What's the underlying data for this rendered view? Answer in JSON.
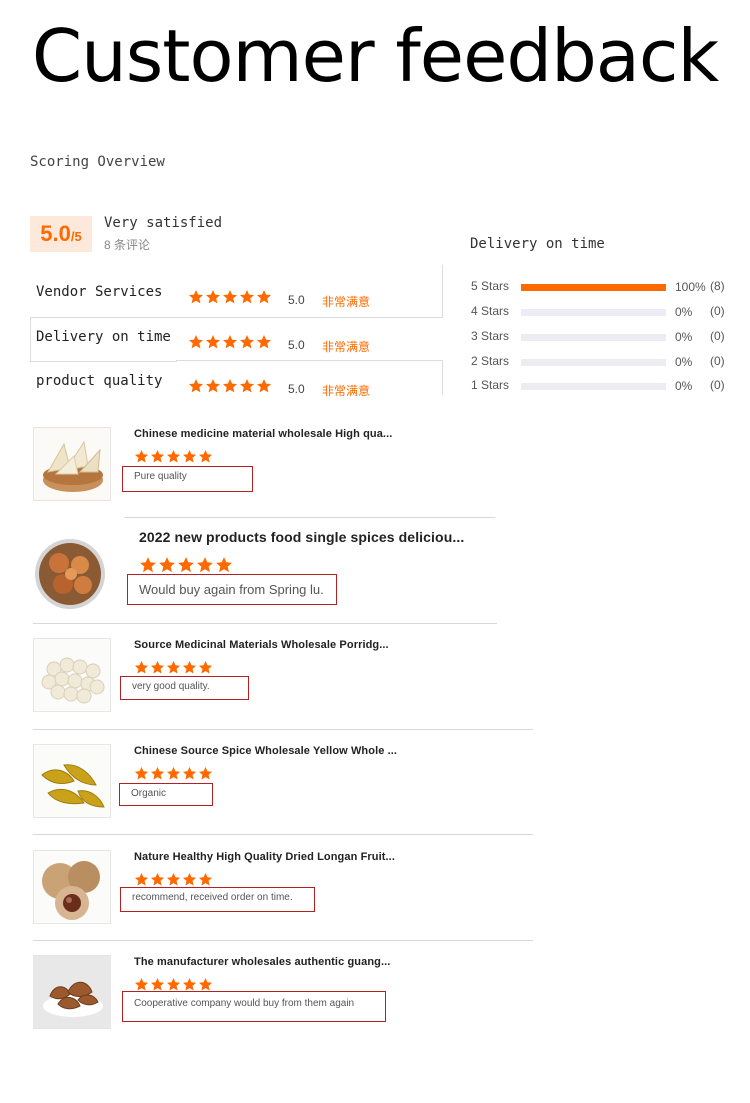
{
  "header": {
    "title": "Customer feedback"
  },
  "overview": {
    "section_title": "Scoring Overview",
    "score": "5.0",
    "score_total": "/5",
    "overall_label": "Very satisfied",
    "review_count": "8 条评论"
  },
  "criteria": [
    {
      "label": "Vendor Services",
      "score": "5.0",
      "text": "非常满意",
      "stars": 5
    },
    {
      "label": "Delivery on time",
      "score": "5.0",
      "text": "非常满意",
      "stars": 5
    },
    {
      "label": "product quality",
      "score": "5.0",
      "text": "非常满意",
      "stars": 5
    }
  ],
  "distribution": {
    "title": "Delivery on time",
    "rows": [
      {
        "label": "5 Stars",
        "percent": "100%",
        "count": "(8)",
        "fraction": 1.0
      },
      {
        "label": "4 Stars",
        "percent": "0%",
        "count": "(0)",
        "fraction": 0
      },
      {
        "label": "3 Stars",
        "percent": "0%",
        "count": "(0)",
        "fraction": 0
      },
      {
        "label": "2 Stars",
        "percent": "0%",
        "count": "(0)",
        "fraction": 0
      },
      {
        "label": "1 Stars",
        "percent": "0%",
        "count": "(0)",
        "fraction": 0
      }
    ]
  },
  "reviews": [
    {
      "title": "Chinese medicine material wholesale High qua...",
      "comment": "Pure quality",
      "stars": 5,
      "image": "sliced-herb-bowl-image"
    },
    {
      "title": "2022 new products food single spices deliciou...",
      "comment": "Would buy again from Spring lu.",
      "stars": 5,
      "image": "dried-citrus-bowl-image"
    },
    {
      "title": "Source Medicinal Materials Wholesale Porridg...",
      "comment": "very good quality.",
      "stars": 5,
      "image": "white-seeds-image"
    },
    {
      "title": "Chinese Source Spice Wholesale Yellow Whole ...",
      "comment": "Organic",
      "stars": 5,
      "image": "turmeric-root-image"
    },
    {
      "title": "Nature Healthy High Quality Dried Longan Fruit...",
      "comment": "recommend, received order on time.",
      "stars": 5,
      "image": "longan-fruit-image"
    },
    {
      "title": "The manufacturer wholesales authentic guang...",
      "comment": "Cooperative company would buy from them again",
      "stars": 5,
      "image": "dried-peel-plate-image"
    }
  ],
  "colors": {
    "accent": "#ff6a00",
    "badge_bg": "#fde8dc",
    "comment_border": "#b22222"
  }
}
